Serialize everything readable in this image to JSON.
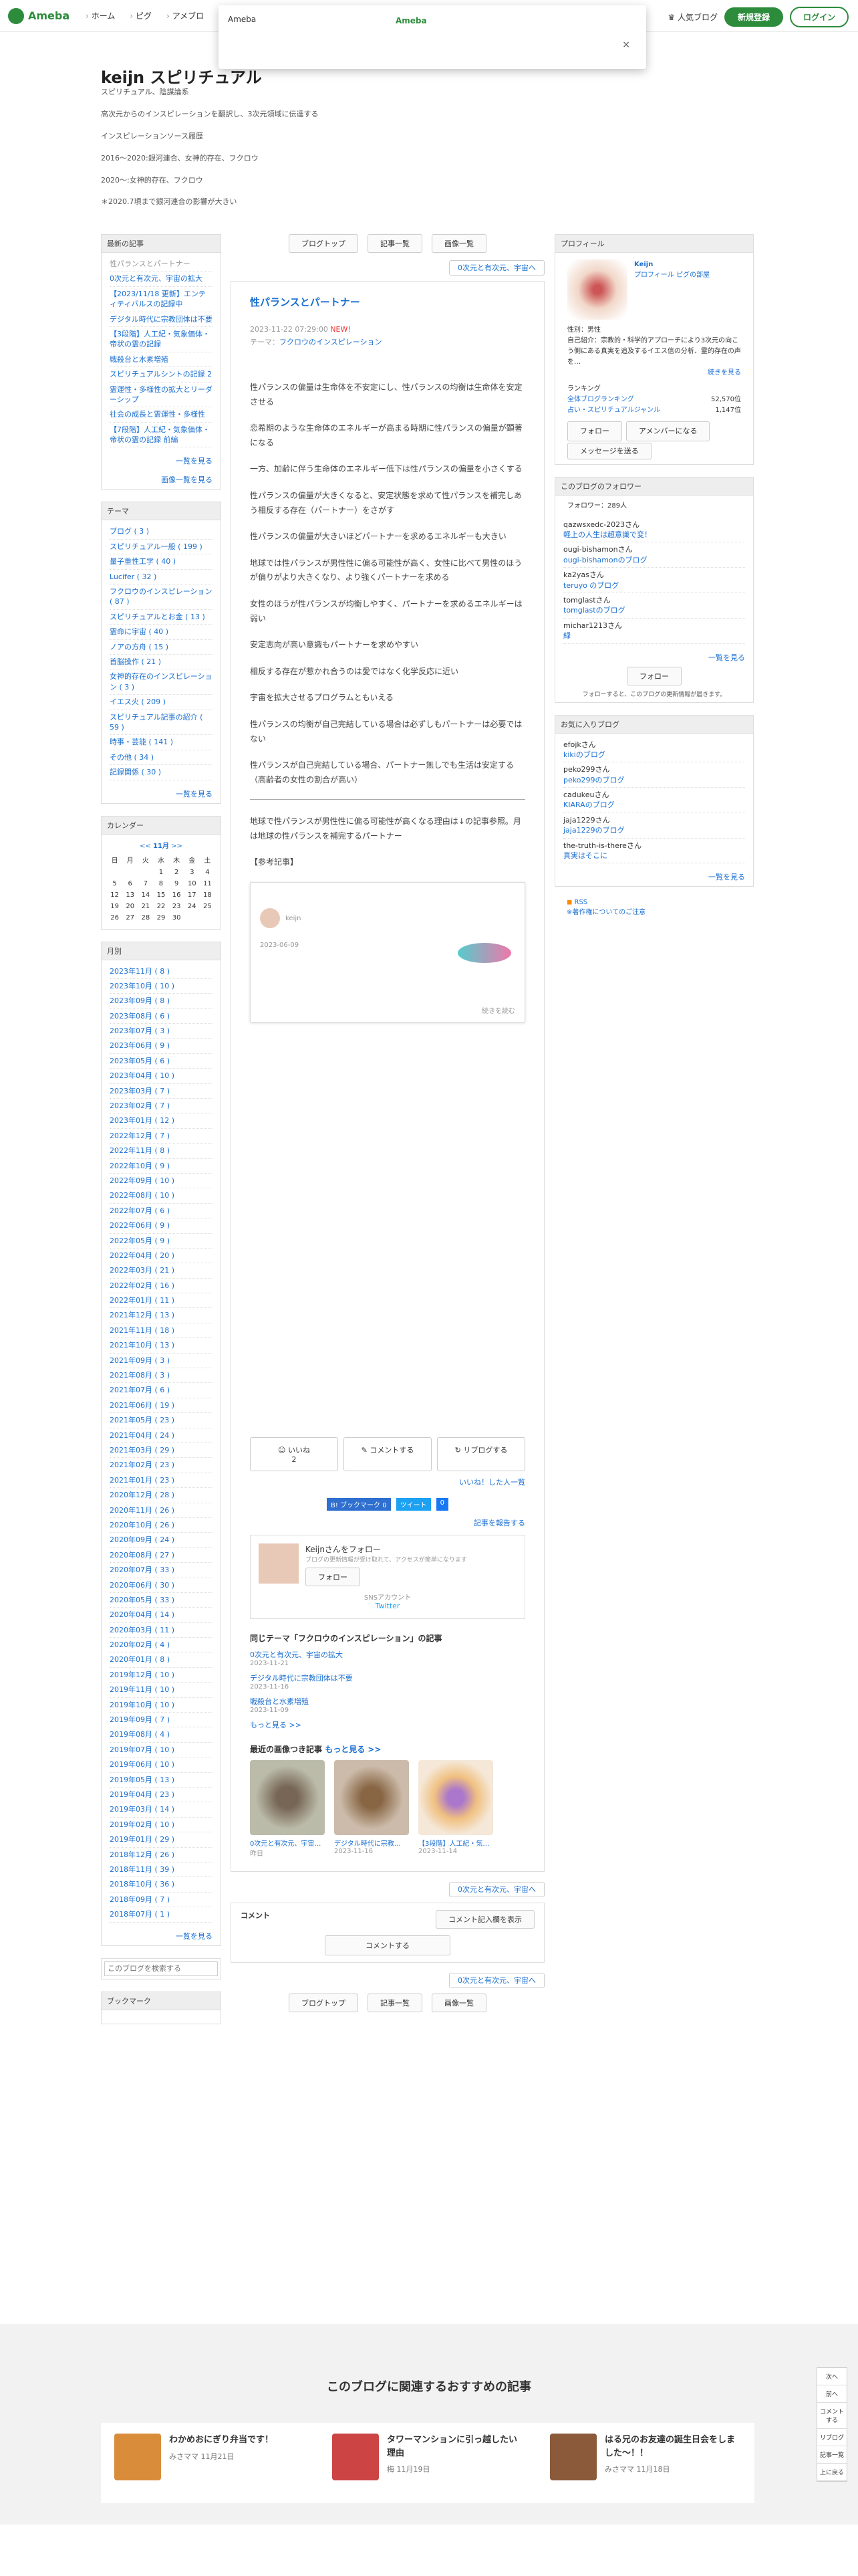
{
  "topbar": {
    "logo": "Ameba",
    "nav": [
      "ホーム",
      "ピグ",
      "アメブロ"
    ],
    "popular": "人気ブログ",
    "signup": "新規登録",
    "login": "ログイン"
  },
  "popup": {
    "title": "Ameba",
    "link": "Ameba",
    "close": "×"
  },
  "blog": {
    "title": "keijn スピリチュアル",
    "lines": [
      "スピリチュアル、陰謀論系",
      "高次元からのインスピレーションを翻訳し、3次元領域に伝達する",
      "インスピレーションソース履歴",
      "2016〜2020:銀河連合、女神的存在、フクロウ",
      "2020〜:女神的存在、フクロウ",
      "＊2020.7頃まで銀河連合の影響が大きい"
    ]
  },
  "nav": {
    "top": "ブログトップ",
    "list": "記事一覧",
    "images": "画像一覧",
    "next": "0次元と有次元、宇宙へ"
  },
  "entry": {
    "title": "性パランスとパートナー",
    "date": "2023-11-22 07:29:00",
    "new": "NEW!",
    "theme_label": "テーマ：",
    "theme": "フクロウのインスピレーション",
    "paras": [
      "性パランスの偏量は生命体を不安定にし、性パランスの均衡は生命体を安定させる",
      "恋希期のような生命体のエネルギーが高まる時期に性パランスの偏量が顕著になる",
      "一方、加齢に伴う生命体のエネルギー低下は性パランスの偏量を小さくする",
      "性パランスの偏量が大きくなると、安定状態を求めて性パランスを補完しあう相反する存在（パートナー）をさがす",
      "性パランスの偏量が大きいほどパートナーを求めるエネルギーも大きい",
      "地球では性パランスが男性性に偏る可能性が高く、女性に比べて男性のほうが偏りがより大きくなり、より強くパートナーを求める",
      "女性のほうが性パランスが均衡しやすく、パートナーを求めるエネルギーは弱い",
      "安定志向が高い意識もパートナーを求めやすい",
      "相反する存在が惹かれ合うのは愛ではなく化学反応に近い",
      "宇宙を拡大させるプログラムともいえる",
      "性パランスの均衡が自己完結している場合は必ずしもパートナーは必要ではない",
      "性パランスが自己完結している場合、パートナー無しでも生活は安定する（高齢者の女性の割合が高い）"
    ],
    "after": "地球で性パランスが男性性に偏る可能性が高くなる理由は↓の記事参照。月は地球の性パランスを補完するパートナー",
    "ref": "【参考記事】",
    "embed_user": "keijn",
    "embed_date": "2023-06-09",
    "embed_more": "続きを読む"
  },
  "actions": {
    "like": "いいね",
    "like_count": "2",
    "comment": "コメントする",
    "reblog": "リブログする",
    "like_list": "いいね！した人一覧",
    "bookmark": "B! ブックマーク",
    "bookmark_count": "0",
    "tweet": "ツイート",
    "fb": "0",
    "report": "記事を報告する"
  },
  "follow_box": {
    "text": "Keijnさんをフォロー",
    "sub": "ブログの更新情報が受け取れて、アクセスが簡単になります",
    "btn": "フォロー",
    "sns": "SNSアカウント",
    "twitter": "Twitter"
  },
  "related": {
    "title": "同じテーマ「フクロウのインスピレーション」の記事",
    "items": [
      {
        "t": "0次元と有次元、宇宙の拡大",
        "d": "2023-11-21"
      },
      {
        "t": "デジタル時代に宗教団体は不要",
        "d": "2023-11-16"
      },
      {
        "t": "戦殺台と水素増殖",
        "d": "2023-11-09"
      }
    ],
    "more": "もっと見る >>"
  },
  "recent_img": {
    "title": "最近の画像つき記事",
    "more": "もっと見る >>",
    "items": [
      {
        "t": "0次元と有次元、宇宙…",
        "d": "昨日"
      },
      {
        "t": "デジタル時代に宗教…",
        "d": "2023-11-16"
      },
      {
        "t": "【3段階】人工紀・気…",
        "d": "2023-11-14"
      }
    ]
  },
  "comment": {
    "title": "コメント",
    "post_btn": "コメント記入欄を表示",
    "btn": "コメントする"
  },
  "left": {
    "recent_title": "最新の記事",
    "recent": [
      "性パランスとパートナー",
      "0次元と有次元、宇宙の拡大",
      "【2023/11/18 更新】エンティティバルスの記録中",
      "デジタル時代に宗教団体は不要",
      "【3段階】人工紀・気象価体・帝状の霊の記録",
      "戦殺台と水素増殖",
      "スピリチュアルシントの記録 2",
      "霊運性・多様性の拡大とリーダーシップ",
      "社会の成長と霊運性・多様性",
      "【7段階】人工紀・気象価体・帝状の霊の記録 前編"
    ],
    "recent_more": "一覧を見る",
    "img_more": "画像一覧を見る",
    "theme_title": "テーマ",
    "themes": [
      "ブログ ( 3 )",
      "スピリチュアル一般 ( 199 )",
      "量子重性工学 ( 40 )",
      "Lucifer ( 32 )",
      "フクロウのインスピレーション ( 87 )",
      "スピリチュアルとお金 ( 13 )",
      "霊命に宇宙 ( 40 )",
      "ノアの方舟 ( 15 )",
      "首脳操作 ( 21 )",
      "女神的存在のインスピレーション ( 3 )",
      "イエス火 ( 209 )",
      "スピリチュアル記事の紹介 ( 59 )",
      "時事・芸能 ( 141 )",
      "その他 ( 34 )",
      "記録関係 ( 30 )"
    ],
    "theme_more": "一覧を見る",
    "cal_title": "カレンダー",
    "cal_month": "11月",
    "cal_days": [
      "日",
      "月",
      "火",
      "水",
      "木",
      "金",
      "土"
    ],
    "cal_rows": [
      [
        "",
        "",
        "",
        "1",
        "2",
        "3",
        "4"
      ],
      [
        "5",
        "6",
        "7",
        "8",
        "9",
        "10",
        "11"
      ],
      [
        "12",
        "13",
        "14",
        "15",
        "16",
        "17",
        "18"
      ],
      [
        "19",
        "20",
        "21",
        "22",
        "23",
        "24",
        "25"
      ],
      [
        "26",
        "27",
        "28",
        "29",
        "30",
        "",
        ""
      ]
    ],
    "monthly_title": "月別",
    "months": [
      "2023年11月 ( 8 )",
      "2023年10月 ( 10 )",
      "2023年09月 ( 8 )",
      "2023年08月 ( 6 )",
      "2023年07月 ( 3 )",
      "2023年06月 ( 9 )",
      "2023年05月 ( 6 )",
      "2023年04月 ( 10 )",
      "2023年03月 ( 7 )",
      "2023年02月 ( 7 )",
      "2023年01月 ( 12 )",
      "2022年12月 ( 7 )",
      "2022年11月 ( 8 )",
      "2022年10月 ( 9 )",
      "2022年09月 ( 10 )",
      "2022年08月 ( 10 )",
      "2022年07月 ( 6 )",
      "2022年06月 ( 9 )",
      "2022年05月 ( 9 )",
      "2022年04月 ( 20 )",
      "2022年03月 ( 21 )",
      "2022年02月 ( 16 )",
      "2022年01月 ( 11 )",
      "2021年12月 ( 13 )",
      "2021年11月 ( 18 )",
      "2021年10月 ( 13 )",
      "2021年09月 ( 3 )",
      "2021年08月 ( 3 )",
      "2021年07月 ( 6 )",
      "2021年06月 ( 19 )",
      "2021年05月 ( 23 )",
      "2021年04月 ( 24 )",
      "2021年03月 ( 29 )",
      "2021年02月 ( 23 )",
      "2021年01月 ( 23 )",
      "2020年12月 ( 28 )",
      "2020年11月 ( 26 )",
      "2020年10月 ( 26 )",
      "2020年09月 ( 24 )",
      "2020年08月 ( 27 )",
      "2020年07月 ( 33 )",
      "2020年06月 ( 30 )",
      "2020年05月 ( 33 )",
      "2020年04月 ( 14 )",
      "2020年03月 ( 11 )",
      "2020年02月 ( 4 )",
      "2020年01月 ( 8 )",
      "2019年12月 ( 10 )",
      "2019年11月 ( 10 )",
      "2019年10月 ( 10 )",
      "2019年09月 ( 7 )",
      "2019年08月 ( 4 )",
      "2019年07月 ( 10 )",
      "2019年06月 ( 10 )",
      "2019年05月 ( 13 )",
      "2019年04月 ( 23 )",
      "2019年03月 ( 14 )",
      "2019年02月 ( 10 )",
      "2019年01月 ( 29 )",
      "2018年12月 ( 26 )",
      "2018年11月 ( 39 )",
      "2018年10月 ( 36 )",
      "2018年09月 ( 7 )",
      "2018年07月 ( 1 )"
    ],
    "monthly_more": "一覧を見る",
    "search_placeholder": "このブログを検索する",
    "bookmark_title": "ブックマーク"
  },
  "right": {
    "profile_title": "プロフィール",
    "name": "Keijn",
    "profile_link": "プロフィール",
    "pigg_link": "ピグの部屋",
    "sex": "性別：男性",
    "intro": "自己紹介：宗教的・科学的アプローチにより3次元の向こう側にある真実を追及するイエス信の分析、霊的存在の声を…",
    "more": "続きを見る",
    "ranking_title": "ランキング",
    "rank1_label": "全体ブログランキング",
    "rank1": "52,570位",
    "rank2_label": "占い・スピリチュアルジャンル",
    "rank2": "1,147位",
    "follow": "フォロー",
    "amember": "アメンバーになる",
    "message": "メッセージを送る",
    "followers_title": "このブログのフォロワー",
    "followers_count": "フォロワー：289人",
    "followers": [
      [
        "qazwsxedc-2023さん",
        "軽上の人生は超意識で変！"
      ],
      [
        "ougi-bishamonさん",
        "ougi-bishamonのブログ"
      ],
      [
        "ka2yasさん",
        "teruyo のブログ"
      ],
      [
        "tomglastさん",
        "tomglastのブログ"
      ],
      [
        "michar1213さん",
        "緑"
      ]
    ],
    "followers_more": "一覧を見る",
    "followers_btn": "フォロー",
    "followers_note": "フォローすると、このブログの更新情報が届きます。",
    "fav_title": "お気に入りブログ",
    "favs": [
      [
        "efojkさん",
        "kikiのブログ"
      ],
      [
        "peko299さん",
        "peko299のブログ"
      ],
      [
        "cadukeuさん",
        "KIARAのブログ"
      ],
      [
        "jaja1229さん",
        "jaja1229のブログ"
      ],
      [
        "the-truth-is-thereさん",
        "真実はそこに"
      ]
    ],
    "fav_more": "一覧を見る",
    "rss": "RSS",
    "rss_sub": "※著作権についてのご注意"
  },
  "footer": {
    "title": "このブログに関連するおすすめの記事",
    "items": [
      {
        "t": "わかめおにぎり弁当です！",
        "by": "みさママ",
        "d": "11月21日"
      },
      {
        "t": "タワーマンションに引っ越したい理由",
        "by": "梅",
        "d": "11月19日"
      },
      {
        "t": "はる兄のお友達の誕生日会をしました〜！！",
        "by": "みさママ",
        "d": "11月18日"
      }
    ]
  },
  "float": [
    "次へ",
    "前へ",
    "コメントする",
    "リブログ",
    "記事一覧",
    "上に戻る"
  ]
}
